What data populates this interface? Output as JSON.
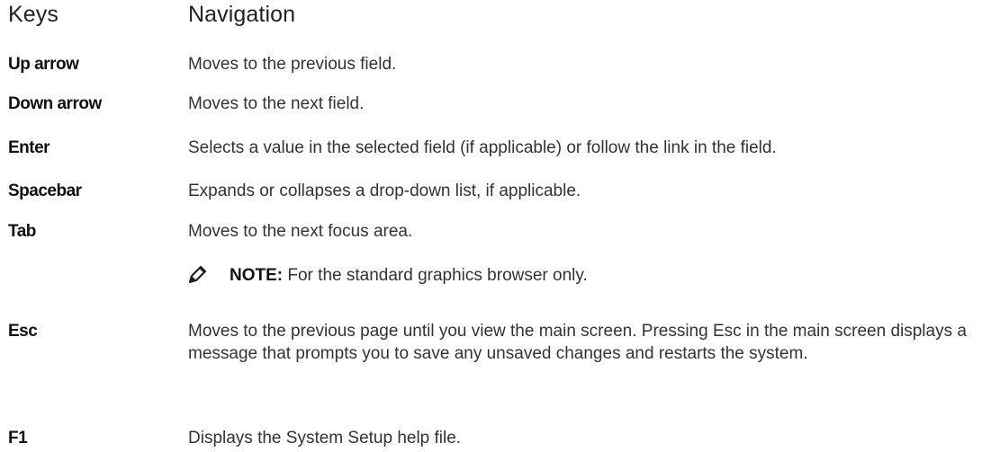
{
  "header": {
    "keys": "Keys",
    "navigation": "Navigation"
  },
  "rows": [
    {
      "key": "Up arrow",
      "description": "Moves to the previous field."
    },
    {
      "key": "Down arrow",
      "description": "Moves to the next field."
    },
    {
      "key": "Enter",
      "description": "Selects a value in the selected field (if applicable) or follow the link in the field."
    },
    {
      "key": "Spacebar",
      "description": "Expands or collapses a drop-down list, if applicable."
    },
    {
      "key": "Tab",
      "description": "Moves to the next focus area."
    },
    {
      "key": "Esc",
      "description": "Moves to the previous page until you view the main screen. Pressing Esc in the main screen displays a message that prompts you to save any unsaved changes and restarts the system."
    },
    {
      "key": "F1",
      "description": "Displays the System Setup help file."
    }
  ],
  "note": {
    "icon": "pencil-icon",
    "label": "NOTE:",
    "text": " For the standard graphics browser only."
  }
}
